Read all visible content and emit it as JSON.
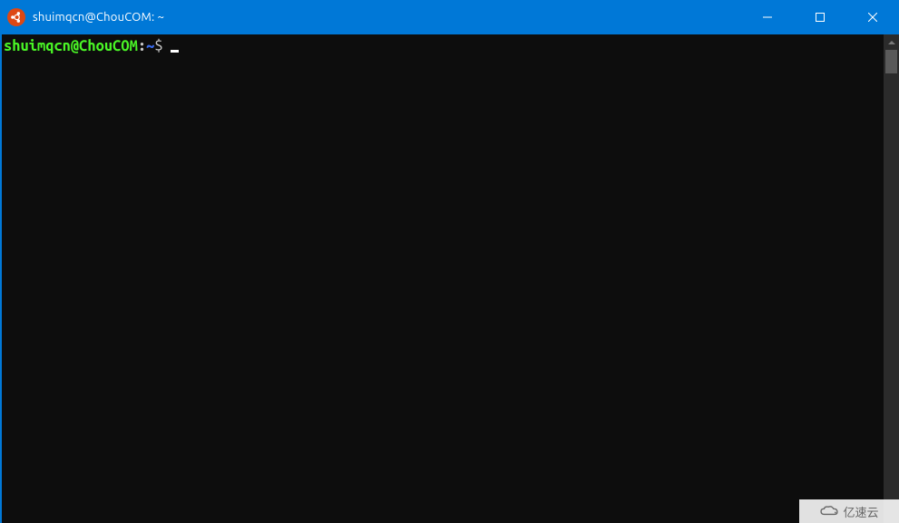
{
  "window": {
    "title": "shuimqcn@ChouCOM: ~"
  },
  "prompt": {
    "user_host": "shuimqcn@ChouCOM",
    "separator": ":",
    "path": "~",
    "symbol": "$"
  },
  "watermark": {
    "text": "亿速云"
  }
}
